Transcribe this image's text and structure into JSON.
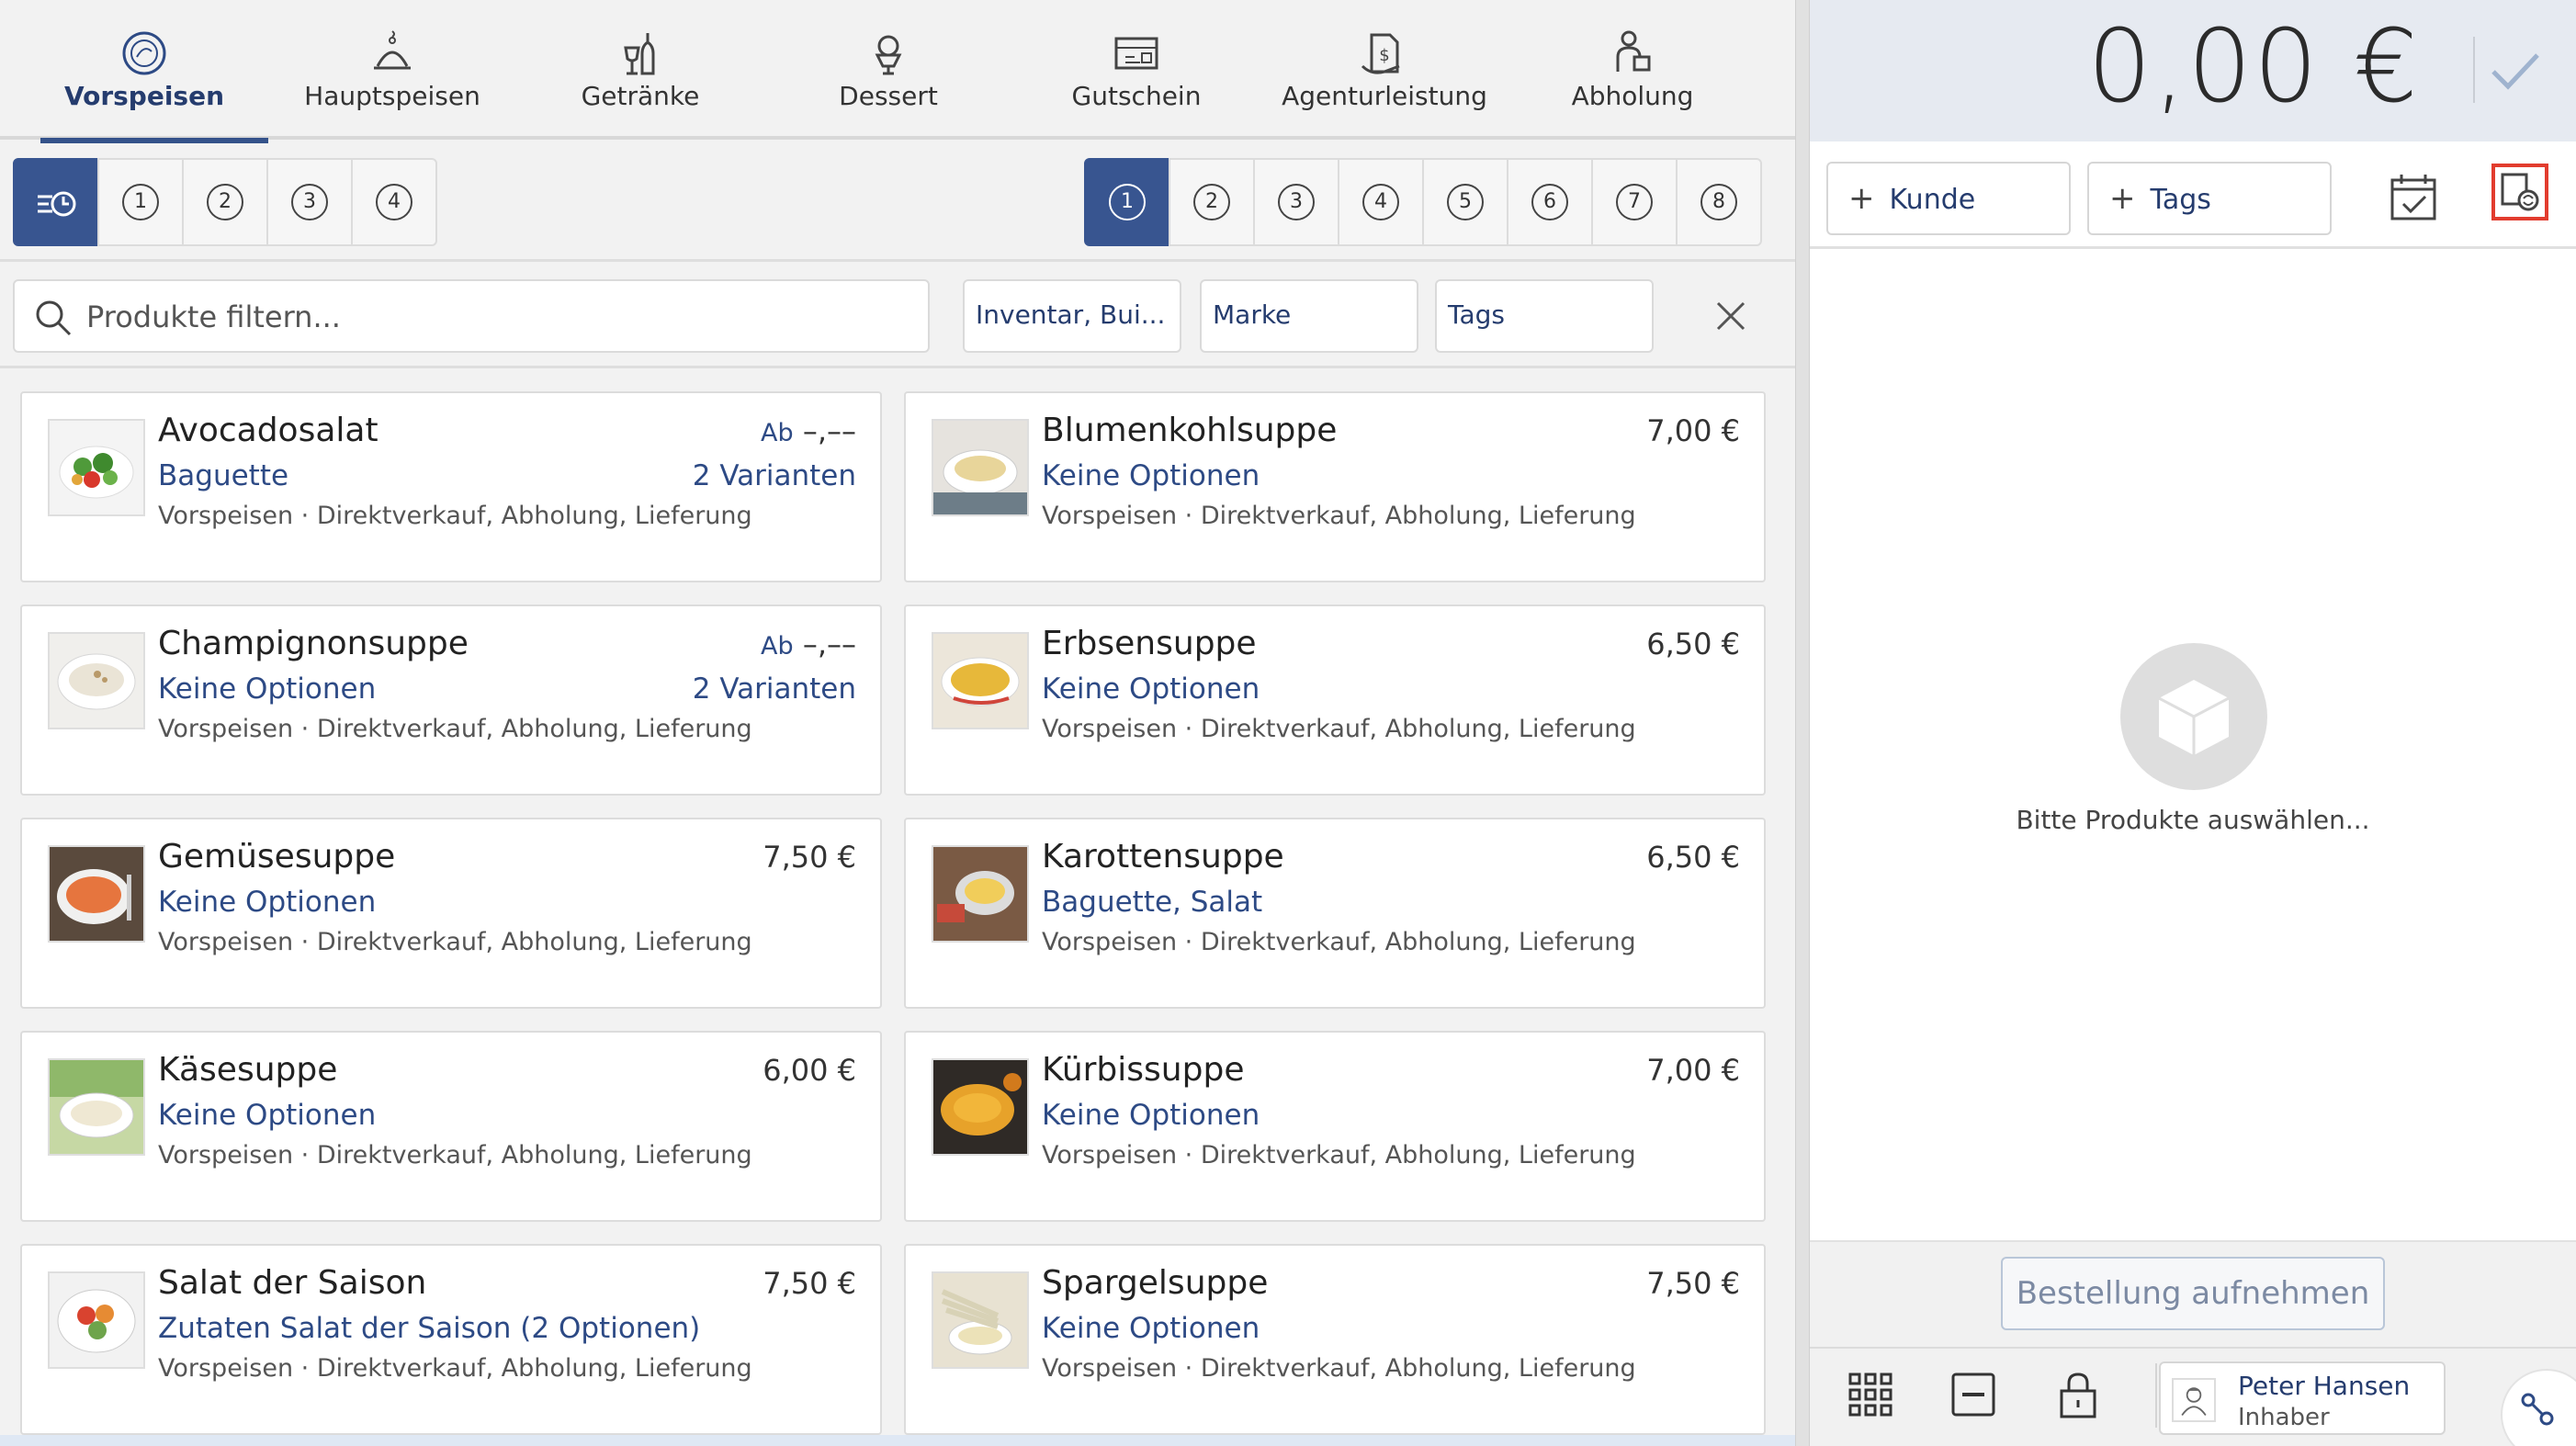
{
  "categories": [
    {
      "label": "Vorspeisen",
      "icon": "salad-plate-icon",
      "active": true
    },
    {
      "label": "Hauptspeisen",
      "icon": "cloche-icon"
    },
    {
      "label": "Getränke",
      "icon": "bottle-glass-icon"
    },
    {
      "label": "Dessert",
      "icon": "ice-cream-icon"
    },
    {
      "label": "Gutschein",
      "icon": "voucher-icon"
    },
    {
      "label": "Agenturleistung",
      "icon": "agency-service-icon"
    },
    {
      "label": "Abholung",
      "icon": "pickup-icon"
    }
  ],
  "course_selector": {
    "icon": "course-timer-icon",
    "courses": [
      "1",
      "2",
      "3",
      "4"
    ]
  },
  "seats": [
    "1",
    "2",
    "3",
    "4",
    "5",
    "6",
    "7",
    "8"
  ],
  "filter": {
    "search_placeholder": "Produkte filtern...",
    "inventory_label": "Inventar, Bui...",
    "brand_label": "Marke",
    "tags_label": "Tags"
  },
  "products": [
    {
      "name": "Avocadosalat",
      "options": "Baguette",
      "meta": "Vorspeisen · Direktverkauf, Abholung, Lieferung",
      "price_prefix": "Ab",
      "price": "–,––",
      "variants": "2 Varianten"
    },
    {
      "name": "Blumenkohlsuppe",
      "options": "Keine Optionen",
      "meta": "Vorspeisen · Direktverkauf, Abholung, Lieferung",
      "price_prefix": "",
      "price": "7,00 €",
      "variants": ""
    },
    {
      "name": "Champignonsuppe",
      "options": "Keine Optionen",
      "meta": "Vorspeisen · Direktverkauf, Abholung, Lieferung",
      "price_prefix": "Ab",
      "price": "–,––",
      "variants": "2 Varianten"
    },
    {
      "name": "Erbsensuppe",
      "options": "Keine Optionen",
      "meta": "Vorspeisen · Direktverkauf, Abholung, Lieferung",
      "price_prefix": "",
      "price": "6,50 €",
      "variants": ""
    },
    {
      "name": "Gemüsesuppe",
      "options": "Keine Optionen",
      "meta": "Vorspeisen · Direktverkauf, Abholung, Lieferung",
      "price_prefix": "",
      "price": "7,50 €",
      "variants": ""
    },
    {
      "name": "Karottensuppe",
      "options": "Baguette, Salat",
      "meta": "Vorspeisen · Direktverkauf, Abholung, Lieferung",
      "price_prefix": "",
      "price": "6,50 €",
      "variants": ""
    },
    {
      "name": "Käsesuppe",
      "options": "Keine Optionen",
      "meta": "Vorspeisen · Direktverkauf, Abholung, Lieferung",
      "price_prefix": "",
      "price": "6,00 €",
      "variants": ""
    },
    {
      "name": "Kürbissuppe",
      "options": "Keine Optionen",
      "meta": "Vorspeisen · Direktverkauf, Abholung, Lieferung",
      "price_prefix": "",
      "price": "7,00 €",
      "variants": ""
    },
    {
      "name": "Salat der Saison",
      "options": "Zutaten Salat der Saison (2 Optionen)",
      "meta": "Vorspeisen · Direktverkauf, Abholung, Lieferung",
      "price_prefix": "",
      "price": "7,50 €",
      "variants": ""
    },
    {
      "name": "Spargelsuppe",
      "options": "Keine Optionen",
      "meta": "Vorspeisen · Direktverkauf, Abholung, Lieferung",
      "price_prefix": "",
      "price": "7,50 €",
      "variants": ""
    }
  ],
  "cart": {
    "total": "0,00 €",
    "customer_label": "Kunde",
    "tags_label": "Tags",
    "empty_text": "Bitte Produkte auswählen...",
    "order_button": "Bestellung aufnehmen"
  },
  "user": {
    "name": "Peter Hansen",
    "role": "Inhaber"
  },
  "colors": {
    "accent": "#385590",
    "text_link": "#2d4a85",
    "highlight_border": "#e23c2e"
  }
}
